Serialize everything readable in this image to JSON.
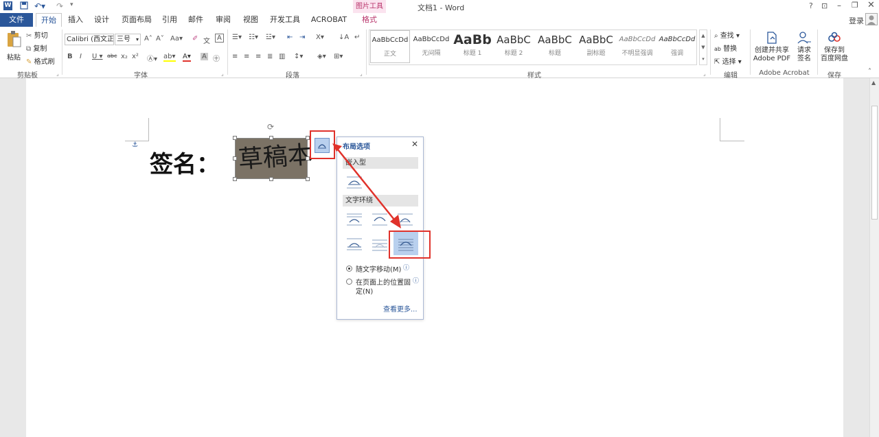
{
  "window": {
    "title": "文档1 - Word",
    "context_tab_group": "图片工具",
    "login": "登录"
  },
  "tabs": [
    "文件",
    "开始",
    "插入",
    "设计",
    "页面布局",
    "引用",
    "邮件",
    "审阅",
    "视图",
    "开发工具",
    "ACROBAT",
    "格式"
  ],
  "ribbon": {
    "clipboard": {
      "paste": "粘贴",
      "cut": "剪切",
      "copy": "复制",
      "format_painter": "格式刷",
      "label": "剪贴板"
    },
    "font": {
      "name": "Calibri (西文正",
      "size": "三号",
      "label": "字体"
    },
    "paragraph": {
      "label": "段落"
    },
    "styles": {
      "label": "样式",
      "items": [
        {
          "preview": "AaBbCcDd",
          "name": "正文"
        },
        {
          "preview": "AaBbCcDd",
          "name": "无间隔"
        },
        {
          "preview": "AaBb",
          "name": "标题 1"
        },
        {
          "preview": "AaBbC",
          "name": "标题 2"
        },
        {
          "preview": "AaBbC",
          "name": "标题"
        },
        {
          "preview": "AaBbC",
          "name": "副标题"
        },
        {
          "preview": "AaBbCcDd",
          "name": "不明显强调"
        },
        {
          "preview": "AaBbCcDd",
          "name": "强调"
        }
      ]
    },
    "editing": {
      "find": "查找",
      "replace": "替换",
      "select": "选择",
      "label": "编辑"
    },
    "acrobat": {
      "create_pdf_1": "创建并共享",
      "create_pdf_2": "Adobe PDF",
      "request_1": "请求",
      "request_2": "签名",
      "label": "Adobe Acrobat"
    },
    "save": {
      "save_1": "保存到",
      "save_2": "百度网盘",
      "label": "保存"
    }
  },
  "document": {
    "signature_label": "签名：",
    "image_text": "草稿本"
  },
  "layout_panel": {
    "title": "布局选项",
    "inline_section": "嵌入型",
    "wrap_section": "文字环绕",
    "opt_move": "随文字移动(M)",
    "opt_fix_1": "在页面上的位置固",
    "opt_fix_2": "定(N)",
    "see_more": "查看更多..."
  },
  "colors": {
    "accent": "#2b579a",
    "highlight": "#e0322b",
    "image_bg": "#7b7265"
  }
}
